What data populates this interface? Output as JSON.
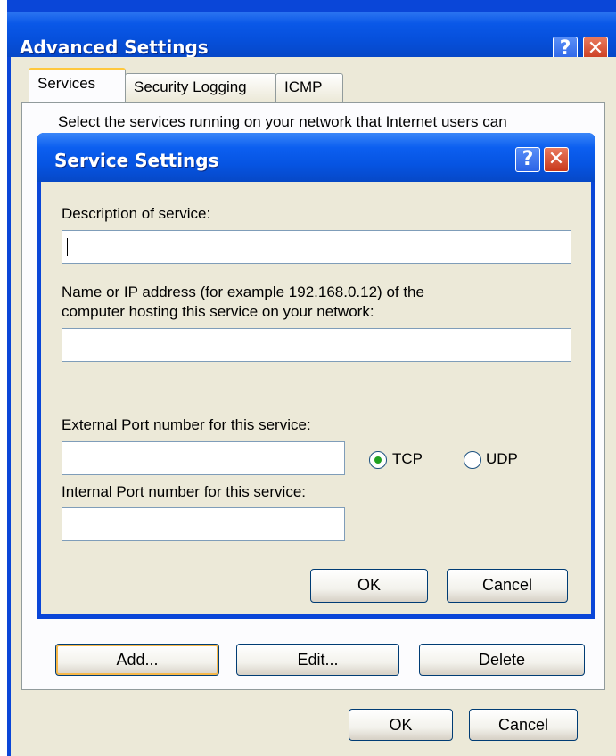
{
  "advanced_settings": {
    "title": "Advanced Settings",
    "help_glyph": "?",
    "close_glyph": "✕",
    "tabs": [
      {
        "label": "Services",
        "active": true
      },
      {
        "label": "Security Logging",
        "active": false
      },
      {
        "label": "ICMP",
        "active": false
      }
    ],
    "panel_text": "Select the services running on your network that Internet users can",
    "buttons": {
      "add": "Add...",
      "edit": "Edit...",
      "delete": "Delete",
      "ok": "OK",
      "cancel": "Cancel"
    }
  },
  "service_settings": {
    "title": "Service Settings",
    "help_glyph": "?",
    "close_glyph": "✕",
    "description_label": "Description of service:",
    "description_value": "",
    "host_label_line1": "Name or IP address (for example 192.168.0.12) of the",
    "host_label_line2": "computer hosting this service on your network:",
    "host_value": "",
    "external_port_label": "External Port number for this service:",
    "external_port_value": "",
    "internal_port_label": "Internal Port number for this service:",
    "internal_port_value": "",
    "protocol": {
      "options": [
        "TCP",
        "UDP"
      ],
      "selected": "TCP"
    },
    "buttons": {
      "ok": "OK",
      "cancel": "Cancel"
    }
  },
  "colors": {
    "titlebar_blue": "#0a58e8",
    "dialog_face": "#ece9d8",
    "default_button_highlight": "#f7b84a",
    "radio_selected": "#21a121"
  }
}
